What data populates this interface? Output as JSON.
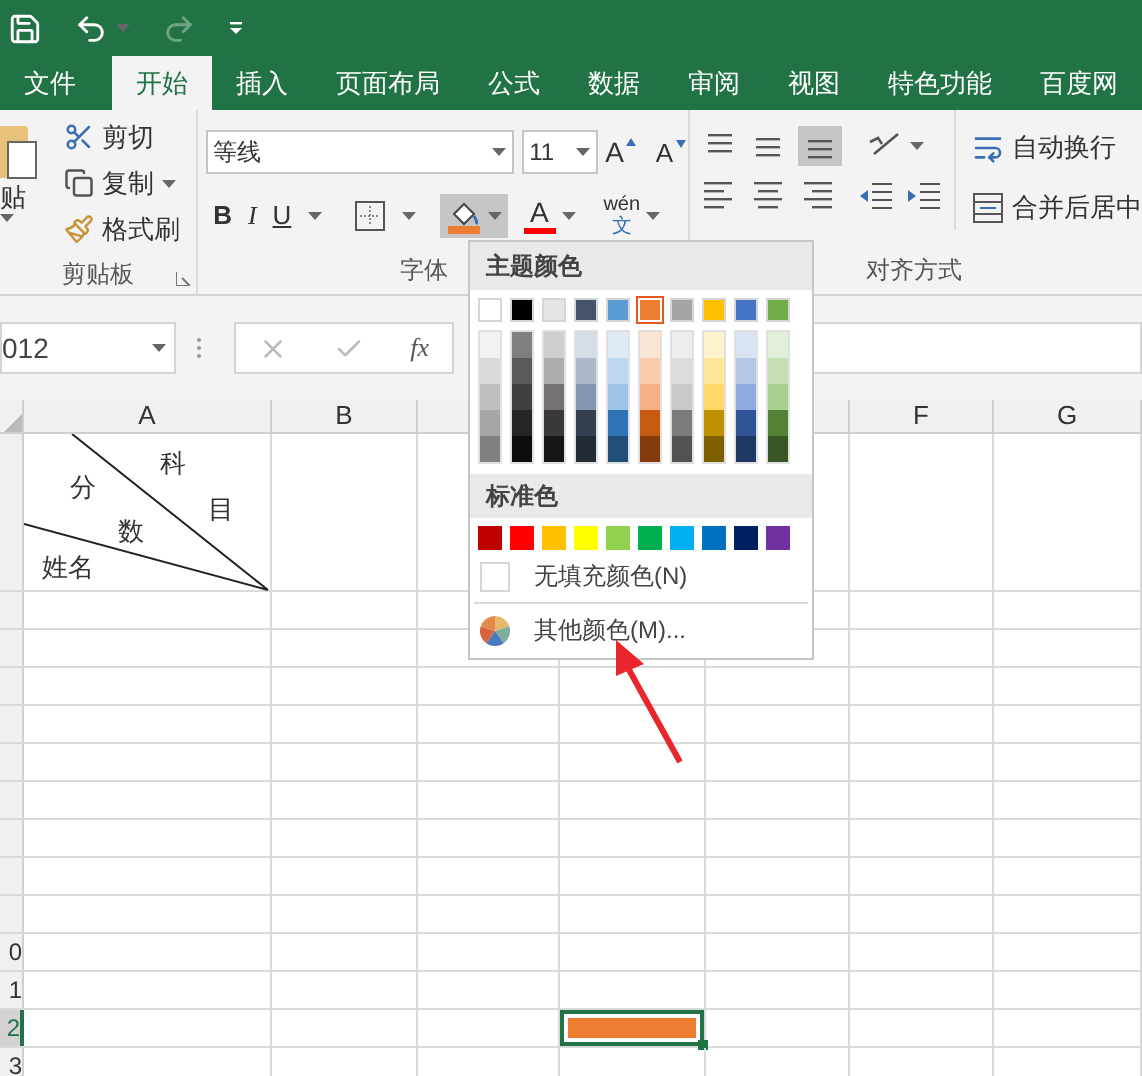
{
  "quick_access": {
    "redo_disabled": true
  },
  "tabs": [
    {
      "label": "文件",
      "selected": false
    },
    {
      "label": "开始",
      "selected": true
    },
    {
      "label": "插入",
      "selected": false
    },
    {
      "label": "页面布局",
      "selected": false
    },
    {
      "label": "公式",
      "selected": false
    },
    {
      "label": "数据",
      "selected": false
    },
    {
      "label": "审阅",
      "selected": false
    },
    {
      "label": "视图",
      "selected": false
    },
    {
      "label": "特色功能",
      "selected": false
    },
    {
      "label": "百度网",
      "selected": false
    }
  ],
  "clipboard": {
    "paste": "贴",
    "cut": "剪切",
    "copy": "复制",
    "format_painter": "格式刷",
    "group_label": "剪贴板"
  },
  "font": {
    "name": "等线",
    "size": "11",
    "grow": "A",
    "shrink": "A",
    "bold": "B",
    "italic": "I",
    "underline": "U",
    "fill_button": {
      "color": "#ed7d31",
      "open": true
    },
    "font_color_button": {
      "letter": "A",
      "color": "#ff0000"
    },
    "phonetic_top": "wén",
    "phonetic_bottom": "文",
    "group_label": "字体"
  },
  "alignment": {
    "bottom_align_selected": true,
    "wrap_text": "自动换行",
    "merge_center": "合并后居中",
    "group_label": "对齐方式"
  },
  "formula_bar": {
    "name_box": "012",
    "function_label": "fx"
  },
  "sheet": {
    "columns": [
      {
        "label": "A"
      },
      {
        "label": "B"
      },
      {},
      {},
      {},
      {
        "label": "F"
      },
      {
        "label": "G"
      }
    ],
    "diagonal_header": {
      "subject": [
        "科",
        "目"
      ],
      "score": [
        "分",
        "数"
      ],
      "name": "姓名"
    },
    "rows": [
      {
        "selected": false
      },
      {
        "selected": false
      },
      {
        "selected": false
      },
      {
        "selected": false
      },
      {
        "selected": false
      },
      {
        "selected": false
      },
      {
        "selected": false
      },
      {
        "selected": false
      },
      {
        "selected": false
      },
      {
        "label": "0",
        "selected": false
      },
      {
        "label": "1",
        "selected": false
      },
      {
        "label": "2",
        "selected": true,
        "cells": [
          {},
          {},
          {},
          {
            "color": "#ed7d31",
            "selected": true
          }
        ]
      },
      {
        "label": "3",
        "selected": false
      }
    ]
  },
  "fill_menu": {
    "theme_title": "主题颜色",
    "theme_colors": [
      {
        "color": "#ffffff",
        "selected": false,
        "shades": [
          {
            "color": "#f2f2f2"
          },
          {
            "color": "#d9d9d9"
          },
          {
            "color": "#bfbfbf"
          },
          {
            "color": "#a6a6a6"
          },
          {
            "color": "#808080"
          }
        ]
      },
      {
        "color": "#000000",
        "selected": false,
        "shades": [
          {
            "color": "#7f7f7f"
          },
          {
            "color": "#595959"
          },
          {
            "color": "#404040"
          },
          {
            "color": "#262626"
          },
          {
            "color": "#0d0d0d"
          }
        ]
      },
      {
        "color": "#e7e6e6",
        "selected": false,
        "shades": [
          {
            "color": "#d0cece"
          },
          {
            "color": "#aeabab"
          },
          {
            "color": "#757171"
          },
          {
            "color": "#3b3838"
          },
          {
            "color": "#171616"
          }
        ]
      },
      {
        "color": "#44546a",
        "selected": false,
        "shades": [
          {
            "color": "#d6dce4"
          },
          {
            "color": "#adb9ca"
          },
          {
            "color": "#8497b0"
          },
          {
            "color": "#333f4f"
          },
          {
            "color": "#222a35"
          }
        ]
      },
      {
        "color": "#5b9bd5",
        "selected": false,
        "shades": [
          {
            "color": "#deebf6"
          },
          {
            "color": "#bdd7ee"
          },
          {
            "color": "#9dc3e6"
          },
          {
            "color": "#2e75b5"
          },
          {
            "color": "#1f4e79"
          }
        ]
      },
      {
        "color": "#ed7d31",
        "selected": true,
        "shades": [
          {
            "color": "#fbe5d5"
          },
          {
            "color": "#f8cbad"
          },
          {
            "color": "#f4b183"
          },
          {
            "color": "#c55a11"
          },
          {
            "color": "#843c0c"
          }
        ]
      },
      {
        "color": "#a5a5a5",
        "selected": false,
        "shades": [
          {
            "color": "#ededed"
          },
          {
            "color": "#dbdbdb"
          },
          {
            "color": "#c9c9c9"
          },
          {
            "color": "#7b7b7b"
          },
          {
            "color": "#525252"
          }
        ]
      },
      {
        "color": "#ffc000",
        "selected": false,
        "shades": [
          {
            "color": "#fff2cc"
          },
          {
            "color": "#ffe699"
          },
          {
            "color": "#ffd966"
          },
          {
            "color": "#bf9000"
          },
          {
            "color": "#7f6000"
          }
        ]
      },
      {
        "color": "#4472c4",
        "selected": false,
        "shades": [
          {
            "color": "#dae3f3"
          },
          {
            "color": "#b4c7e7"
          },
          {
            "color": "#8faadc"
          },
          {
            "color": "#2f5597"
          },
          {
            "color": "#203864"
          }
        ]
      },
      {
        "color": "#70ad47",
        "selected": false,
        "shades": [
          {
            "color": "#e2f0d9"
          },
          {
            "color": "#c5e0b4"
          },
          {
            "color": "#a9d18e"
          },
          {
            "color": "#538135"
          },
          {
            "color": "#375623"
          }
        ]
      }
    ],
    "standard_title": "标准色",
    "standard_colors": [
      {
        "color": "#c00000",
        "selected": false
      },
      {
        "color": "#ff0000",
        "selected": false
      },
      {
        "color": "#ffc000",
        "selected": false
      },
      {
        "color": "#ffff00",
        "selected": false
      },
      {
        "color": "#92d050",
        "selected": false
      },
      {
        "color": "#00b050",
        "selected": false
      },
      {
        "color": "#00b0f0",
        "selected": false
      },
      {
        "color": "#0070c0",
        "selected": false
      },
      {
        "color": "#002060",
        "selected": false
      },
      {
        "color": "#7030a0",
        "selected": false
      }
    ],
    "no_fill": "无填充颜色(N)",
    "more_colors": "其他颜色(M)..."
  },
  "annotation": {
    "kind": "arrow",
    "color": "#e8262c"
  }
}
